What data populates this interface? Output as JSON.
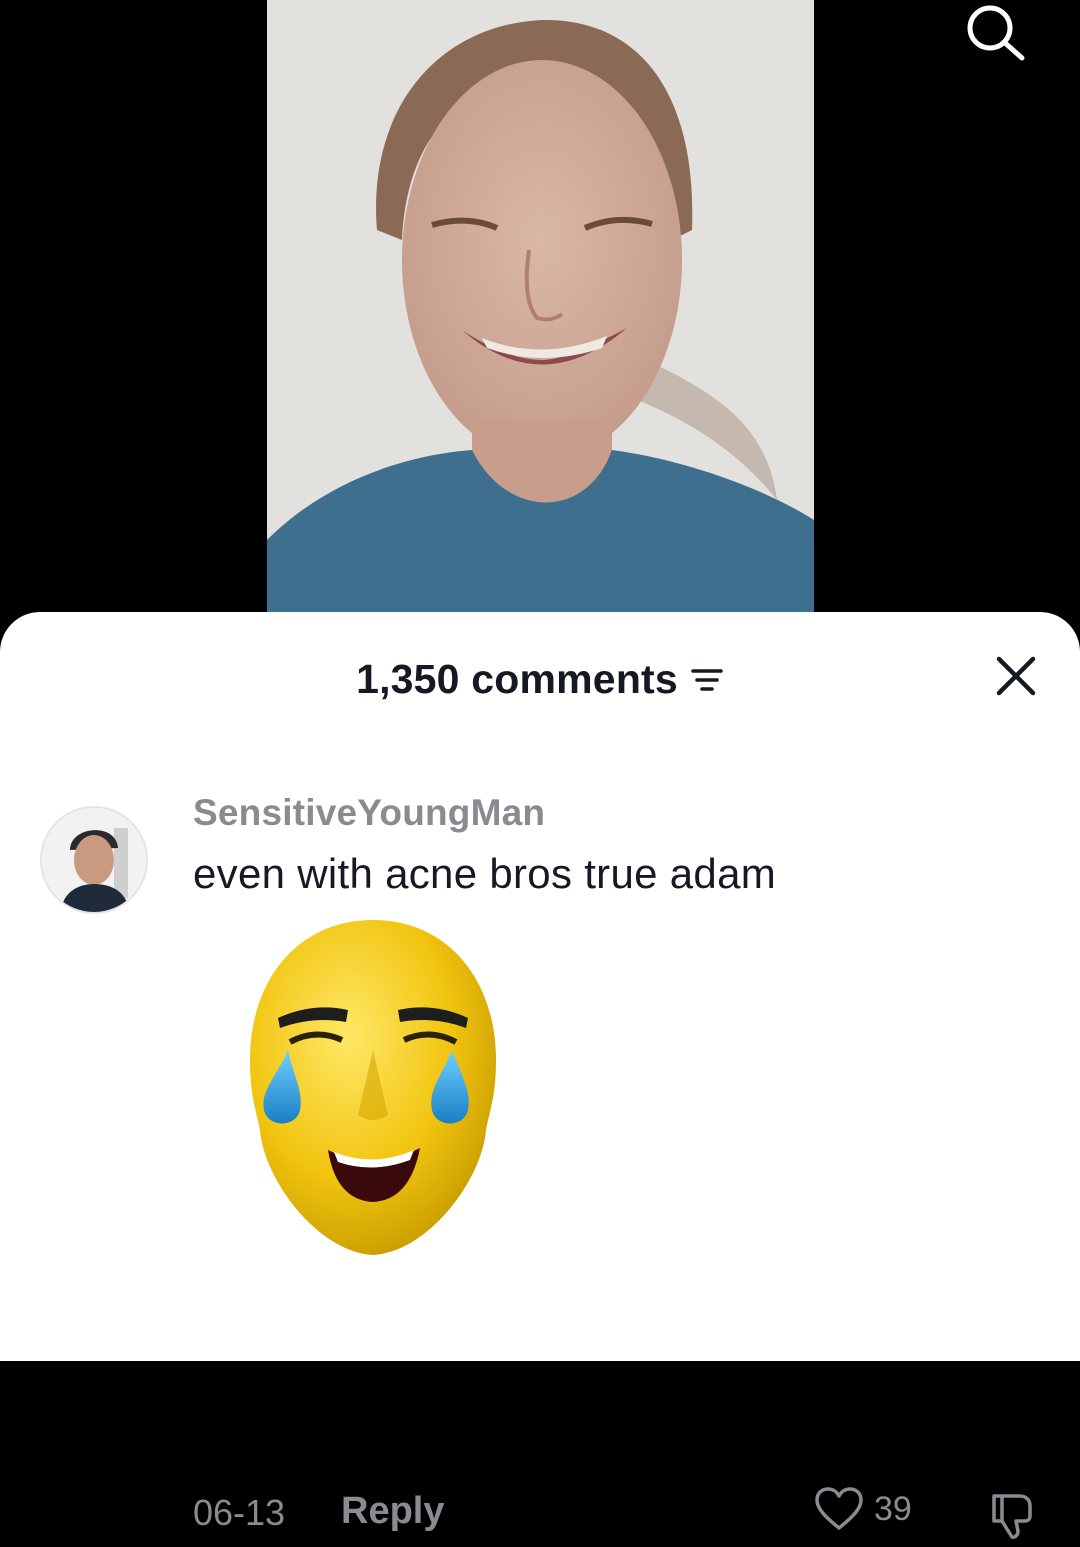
{
  "header": {
    "comment_count": "1,350 comments"
  },
  "comment": {
    "username": "SensitiveYoungMan",
    "text": "even with acne bros true adam",
    "date": "06-13",
    "reply_label": "Reply",
    "likes": "39"
  },
  "icons": {
    "search": "search-icon",
    "sort": "sort-filter-icon",
    "close": "close-icon",
    "like": "heart-icon",
    "dislike": "thumbs-down-icon"
  },
  "colors": {
    "text_primary": "#161823",
    "text_secondary": "#8a8b91",
    "sheet_bg": "#ffffff",
    "video_bg": "#000000",
    "sticker_yellow": "#f1c40f"
  }
}
